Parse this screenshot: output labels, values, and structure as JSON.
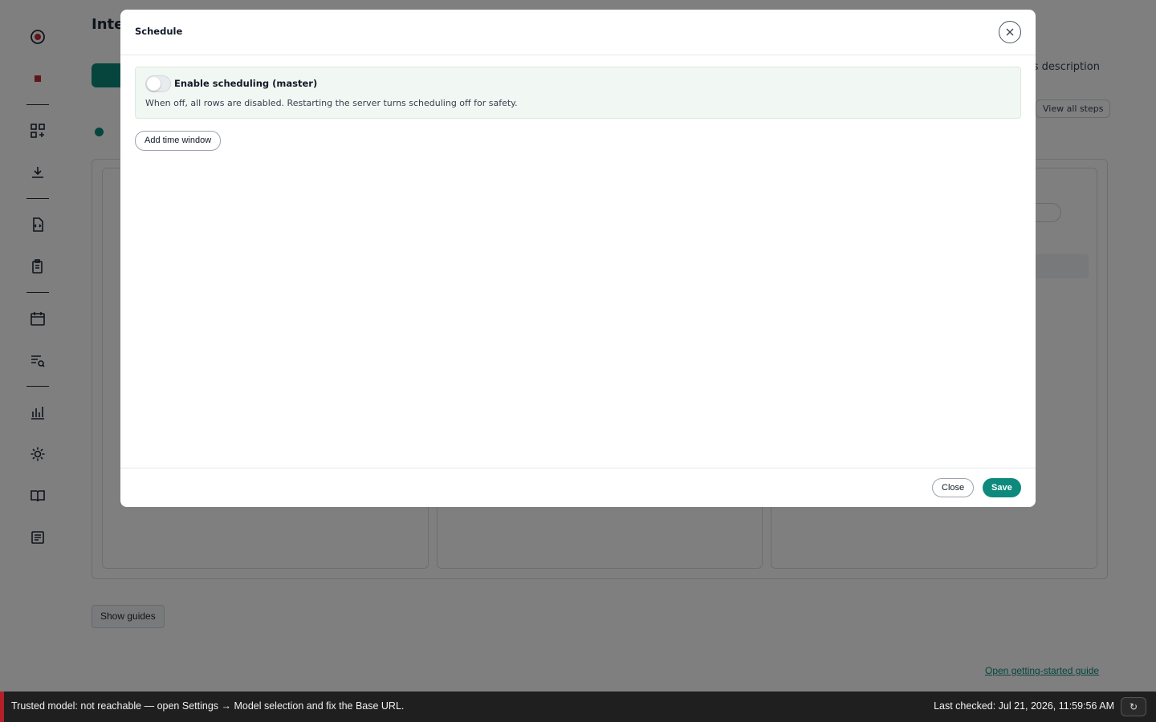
{
  "app": {
    "page_title": "Inte",
    "background_link_text": "ss description",
    "view_all_steps": "View all steps",
    "show_guides": "Show guides",
    "getting_started_link": "Open getting-started guide"
  },
  "sidebar": {
    "icons": [
      "record-icon",
      "stop-icon",
      "apps-icon",
      "download-icon",
      "code-file-icon",
      "clipboard-icon",
      "calendar-icon",
      "search-list-icon",
      "bar-chart-icon",
      "settings-icon",
      "book-icon",
      "notes-icon"
    ]
  },
  "modal": {
    "title": "Schedule",
    "master_label": "Enable scheduling (master)",
    "master_enabled": false,
    "master_help": "When off, all rows are disabled. Restarting the server turns scheduling off for safety.",
    "add_window_label": "Add time window",
    "close_label": "Close",
    "save_label": "Save"
  },
  "status": {
    "message": "Trusted model: not reachable — open Settings → Model selection and fix the Base URL.",
    "last_checked": "Last checked: Jul 21, 2026, 11:59:56 AM",
    "refresh_glyph": "↻"
  },
  "colors": {
    "accent": "#0d8a7c",
    "error": "#b3202a",
    "statusbar_bg": "#1f1f1f"
  }
}
